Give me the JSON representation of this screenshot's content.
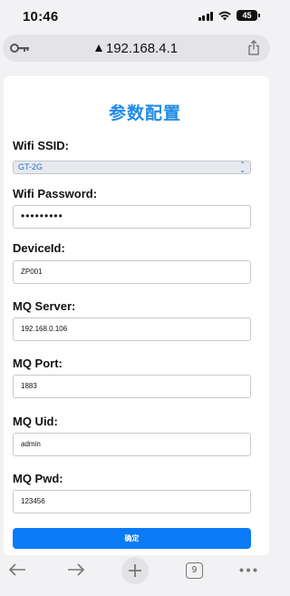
{
  "status_bar": {
    "time": "10:46",
    "battery": "45"
  },
  "browser": {
    "url": "192.168.4.1",
    "tab_count": "9"
  },
  "form": {
    "title": "参数配置",
    "fields": [
      {
        "label": "Wifi SSID:",
        "type": "select",
        "value": "GT-2G"
      },
      {
        "label": "Wifi Password:",
        "type": "password",
        "value": "•••••••••"
      },
      {
        "label": "DeviceId:",
        "type": "text",
        "value": "ZP001"
      },
      {
        "label": "MQ Server:",
        "type": "text",
        "value": "192.168.0.106"
      },
      {
        "label": "MQ Port:",
        "type": "text",
        "value": "1883"
      },
      {
        "label": "MQ Uid:",
        "type": "text",
        "value": "admin"
      },
      {
        "label": "MQ Pwd:",
        "type": "text",
        "value": "123456"
      }
    ],
    "submit_label": "确定"
  },
  "colors": {
    "accent": "#1f8be6",
    "button": "#0a7bf5"
  },
  "icons": [
    "key-icon",
    "lock-icon",
    "share-icon",
    "back-arrow-icon",
    "forward-arrow-icon",
    "plus-icon",
    "tabs-icon",
    "more-icon"
  ]
}
